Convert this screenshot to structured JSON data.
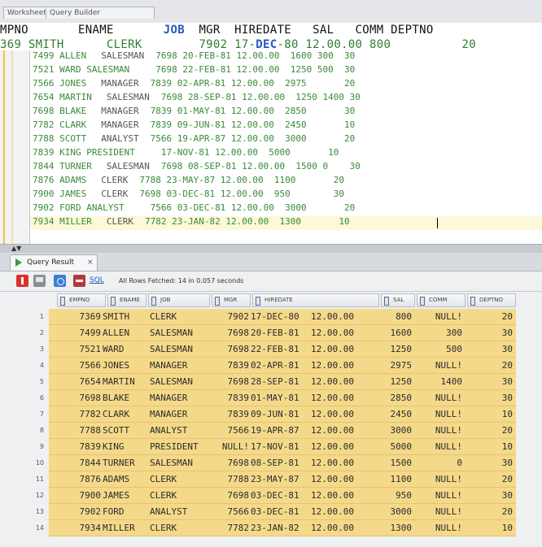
{
  "top_tabs": [
    "Worksheet",
    "Query Builder"
  ],
  "editor": {
    "overlay_header": {
      "c1": "MPNO",
      "c2": "ENAME",
      "c3": "JOB",
      "c4": "MGR",
      "c5": "HIREDATE",
      "c6": "SAL",
      "c7": "COMM",
      "c8": "DEPTNO"
    },
    "overlay_row": {
      "c1": "369",
      "c2": "SMITH",
      "c3": "CLERK",
      "c4": "7902",
      "c5a": "17-",
      "c5b": "DEC",
      "c5c": "-80",
      "c6": "12.00.00",
      "c7": "800",
      "c8": "20"
    },
    "lines": [
      {
        "a": "7499 ALLEN",
        "b": "SALESMAN",
        "c": "7698 20-FEB-81 12.00.00  1600 300  30"
      },
      {
        "a": "7521 WARD SALESMAN",
        "b": "",
        "c": "7698 22-FEB-81 12.00.00  1250 500  30"
      },
      {
        "a": "7566 JONES",
        "b": "MANAGER",
        "c": "7839 02-APR-81 12.00.00  2975       20"
      },
      {
        "a": "7654 MARTIN",
        "b": "SALESMAN",
        "c": "7698 28-SEP-81 12.00.00  1250 1400 30"
      },
      {
        "a": "7698 BLAKE",
        "b": "MANAGER",
        "c": "7839 01-MAY-81 12.00.00  2850       30"
      },
      {
        "a": "7782 CLARK",
        "b": "MANAGER",
        "c": "7839 09-JUN-81 12.00.00  2450       10"
      },
      {
        "a": "7788 SCOTT",
        "b": "ANALYST",
        "c": "7566 19-APR-87 12.00.00  3000       20"
      },
      {
        "a": "7839 KING PRESIDENT",
        "b": "",
        "c": "17-NOV-81 12.00.00  5000       10"
      },
      {
        "a": "7844 TURNER",
        "b": "SALESMAN",
        "c": "7698 08-SEP-81 12.00.00  1500 0    30"
      },
      {
        "a": "7876 ADAMS",
        "b": "CLERK",
        "c": "7788 23-MAY-87 12.00.00  1100       20"
      },
      {
        "a": "7900 JAMES",
        "b": "CLERK",
        "c": "7698 03-DEC-81 12.00.00  950        30"
      },
      {
        "a": "7902 FORD ANALYST",
        "b": "",
        "c": "7566 03-DEC-81 12.00.00  3000       20"
      },
      {
        "a": "7934 MILLER",
        "b": "CLERK",
        "c": "7782 23-JAN-82 12.00.00  1300       10"
      }
    ]
  },
  "result_tab": {
    "label": "Query Result",
    "close": "×"
  },
  "toolbar": {
    "sql_label": "SQL",
    "fetch_status": "All Rows Fetched: 14 in 0.057 seconds"
  },
  "columns": [
    "EMPNO",
    "ENAME",
    "JOB",
    "MGR",
    "HIREDATE",
    "SAL",
    "COMM",
    "DEPTNO"
  ],
  "rows": [
    {
      "n": "1",
      "empno": "7369",
      "ename": "SMITH",
      "job": "CLERK",
      "mgr": "7902",
      "hire": "17-DEC-80",
      "time": "12.00.00",
      "sal": "800",
      "comm": "NULL!",
      "dept": "20"
    },
    {
      "n": "2",
      "empno": "7499",
      "ename": "ALLEN",
      "job": "SALESMAN",
      "mgr": "7698",
      "hire": "20-FEB-81",
      "time": "12.00.00",
      "sal": "1600",
      "comm": "300",
      "dept": "30"
    },
    {
      "n": "3",
      "empno": "7521",
      "ename": "WARD",
      "job": "SALESMAN",
      "mgr": "7698",
      "hire": "22-FEB-81",
      "time": "12.00.00",
      "sal": "1250",
      "comm": "500",
      "dept": "30"
    },
    {
      "n": "4",
      "empno": "7566",
      "ename": "JONES",
      "job": "MANAGER",
      "mgr": "7839",
      "hire": "02-APR-81",
      "time": "12.00.00",
      "sal": "2975",
      "comm": "NULL!",
      "dept": "20"
    },
    {
      "n": "5",
      "empno": "7654",
      "ename": "MARTIN",
      "job": "SALESMAN",
      "mgr": "7698",
      "hire": "28-SEP-81",
      "time": "12.00.00",
      "sal": "1250",
      "comm": "1400",
      "dept": "30"
    },
    {
      "n": "6",
      "empno": "7698",
      "ename": "BLAKE",
      "job": "MANAGER",
      "mgr": "7839",
      "hire": "01-MAY-81",
      "time": "12.00.00",
      "sal": "2850",
      "comm": "NULL!",
      "dept": "30"
    },
    {
      "n": "7",
      "empno": "7782",
      "ename": "CLARK",
      "job": "MANAGER",
      "mgr": "7839",
      "hire": "09-JUN-81",
      "time": "12.00.00",
      "sal": "2450",
      "comm": "NULL!",
      "dept": "10"
    },
    {
      "n": "8",
      "empno": "7788",
      "ename": "SCOTT",
      "job": "ANALYST",
      "mgr": "7566",
      "hire": "19-APR-87",
      "time": "12.00.00",
      "sal": "3000",
      "comm": "NULL!",
      "dept": "20"
    },
    {
      "n": "9",
      "empno": "7839",
      "ename": "KING",
      "job": "PRESIDENT",
      "mgr": "NULL!",
      "hire": "17-NOV-81",
      "time": "12.00.00",
      "sal": "5000",
      "comm": "NULL!",
      "dept": "10"
    },
    {
      "n": "10",
      "empno": "7844",
      "ename": "TURNER",
      "job": "SALESMAN",
      "mgr": "7698",
      "hire": "08-SEP-81",
      "time": "12.00.00",
      "sal": "1500",
      "comm": "0",
      "dept": "30"
    },
    {
      "n": "11",
      "empno": "7876",
      "ename": "ADAMS",
      "job": "CLERK",
      "mgr": "7788",
      "hire": "23-MAY-87",
      "time": "12.00.00",
      "sal": "1100",
      "comm": "NULL!",
      "dept": "20"
    },
    {
      "n": "12",
      "empno": "7900",
      "ename": "JAMES",
      "job": "CLERK",
      "mgr": "7698",
      "hire": "03-DEC-81",
      "time": "12.00.00",
      "sal": "950",
      "comm": "NULL!",
      "dept": "30"
    },
    {
      "n": "13",
      "empno": "7902",
      "ename": "FORD",
      "job": "ANALYST",
      "mgr": "7566",
      "hire": "03-DEC-81",
      "time": "12.00.00",
      "sal": "3000",
      "comm": "NULL!",
      "dept": "20"
    },
    {
      "n": "14",
      "empno": "7934",
      "ename": "MILLER",
      "job": "CLERK",
      "mgr": "7782",
      "hire": "23-JAN-82",
      "time": "12.00.00",
      "sal": "1300",
      "comm": "NULL!",
      "dept": "10"
    }
  ]
}
